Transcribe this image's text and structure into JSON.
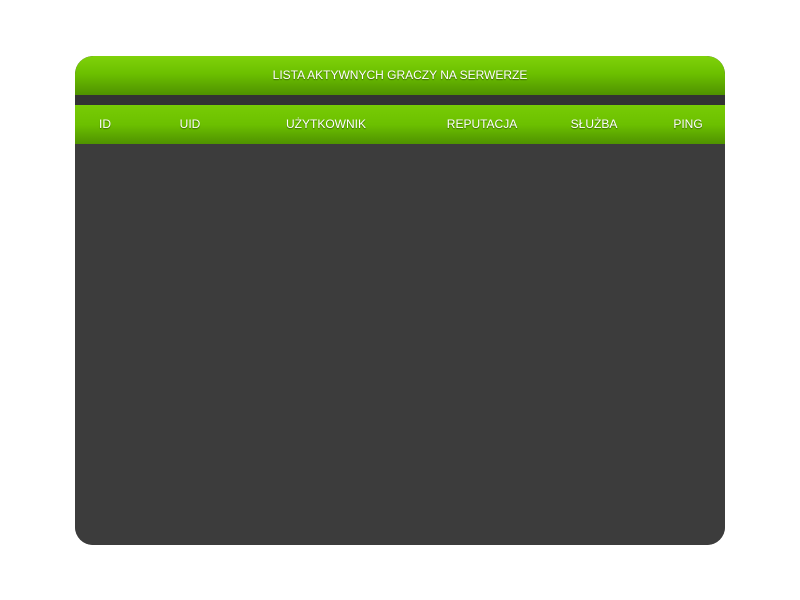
{
  "panel": {
    "title": "LISTA AKTYWNYCH GRACZY NA SERWERZE"
  },
  "table": {
    "columns": [
      "ID",
      "UID",
      "UŻYTKOWNIK",
      "REPUTACJA",
      "SŁUŻBA",
      "PING"
    ],
    "rows": []
  },
  "colors": {
    "accent_green": "#6cc000",
    "accent_green_dark": "#4f9200",
    "panel_background": "#3c3c3c",
    "text": "#ffffff"
  }
}
